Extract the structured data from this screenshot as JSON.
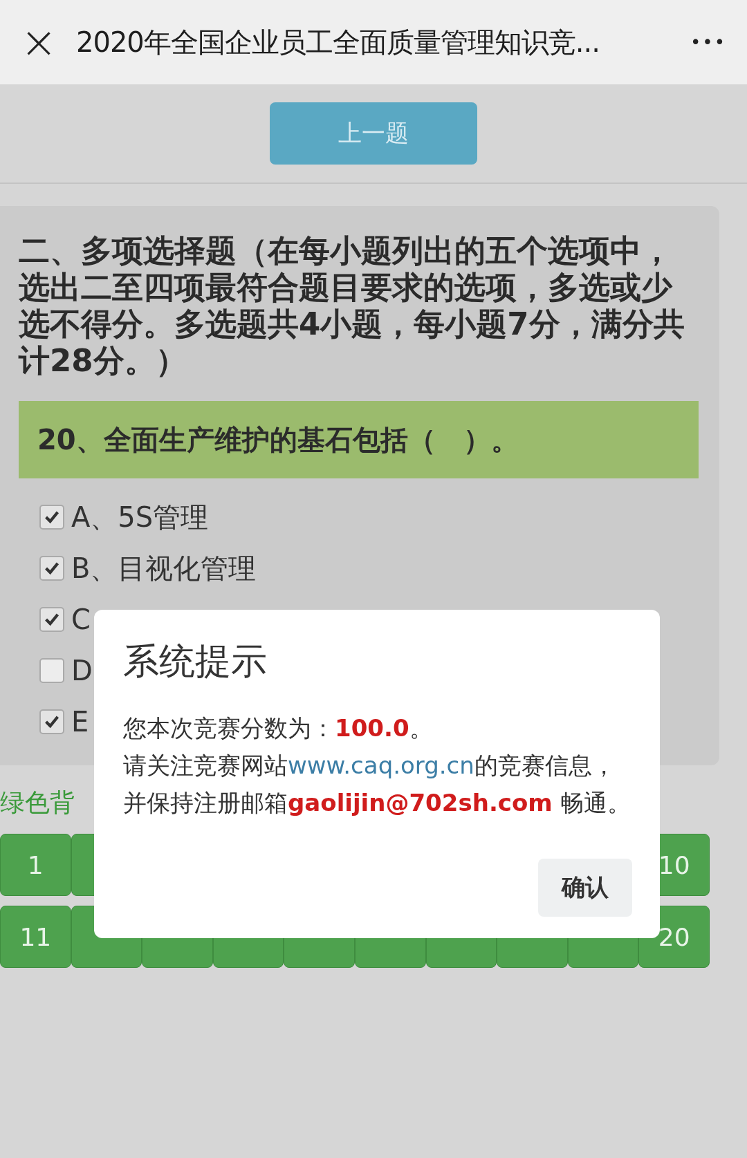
{
  "header": {
    "close": "×",
    "title": "2020年全国企业员工全面质量管理知识竞...",
    "more": "•••"
  },
  "prev_button": "上一题",
  "section_heading": "二、多项选择题（在每小题列出的五个选项中，选出二至四项最符合题目要求的选项，多选或少选不得分。多选题共4小题，每小题7分，满分共计28分。）",
  "question": "20、全面生产维护的基石包括（　）。",
  "options": [
    {
      "label": "A、5S管理",
      "checked": true
    },
    {
      "label": "B、目视化管理",
      "checked": true
    },
    {
      "label": "C",
      "checked": true
    },
    {
      "label": "D",
      "checked": false
    },
    {
      "label": "E",
      "checked": true
    }
  ],
  "legend": "绿色背",
  "grid_rows": [
    {
      "buttons": [
        {
          "kind": "number",
          "label": "1"
        },
        {
          "kind": "covered"
        },
        {
          "kind": "number",
          "label": "10"
        }
      ]
    },
    {
      "buttons": [
        {
          "kind": "number",
          "label": "11"
        },
        {
          "kind": "covered"
        },
        {
          "kind": "covered"
        },
        {
          "kind": "covered"
        },
        {
          "kind": "covered"
        },
        {
          "kind": "covered"
        },
        {
          "kind": "covered"
        },
        {
          "kind": "covered"
        },
        {
          "kind": "covered"
        },
        {
          "kind": "number",
          "label": "20"
        }
      ]
    }
  ],
  "dialog": {
    "title": "系统提示",
    "lines": [
      [
        {
          "kind": "plain",
          "text": "您本次竞赛分数为："
        },
        {
          "kind": "highlight",
          "text": "100.0"
        },
        {
          "kind": "plain",
          "text": "。"
        }
      ],
      [
        {
          "kind": "plain",
          "text": "请关注竞赛网站"
        },
        {
          "kind": "link",
          "text": "www.caq.org.cn"
        },
        {
          "kind": "plain",
          "text": "的竞赛信息，"
        }
      ],
      [
        {
          "kind": "plain",
          "text": "并保持注册邮箱"
        },
        {
          "kind": "highlight",
          "text": "gaolijin@702sh.com"
        },
        {
          "kind": "plain",
          "text": " 畅通。"
        }
      ]
    ],
    "confirm": "确认"
  }
}
